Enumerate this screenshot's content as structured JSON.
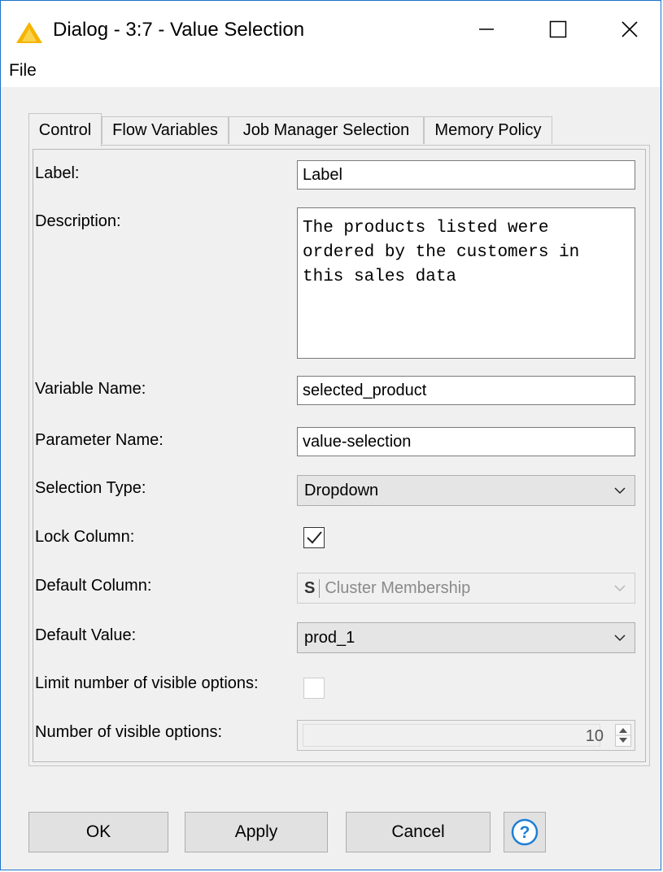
{
  "window": {
    "title": "Dialog - 3:7 - Value Selection",
    "icon": "warning-triangle-icon",
    "accent": "#f5b400"
  },
  "menu": {
    "file": "File"
  },
  "tabs": [
    {
      "label": "Control",
      "active": true
    },
    {
      "label": "Flow Variables",
      "active": false
    },
    {
      "label": "Job Manager Selection",
      "active": false
    },
    {
      "label": "Memory Policy",
      "active": false
    }
  ],
  "form": {
    "label": {
      "caption": "Label:",
      "value": "Label"
    },
    "description": {
      "caption": "Description:",
      "value": "The products listed were ordered by the customers in this sales data"
    },
    "variable_name": {
      "caption": "Variable Name:",
      "value": "selected_product"
    },
    "parameter_name": {
      "caption": "Parameter Name:",
      "value": "value-selection"
    },
    "selection_type": {
      "caption": "Selection Type:",
      "value": "Dropdown"
    },
    "lock_column": {
      "caption": "Lock Column:",
      "checked": true
    },
    "default_column": {
      "caption": "Default Column:",
      "type_badge": "S",
      "value": "Cluster Membership",
      "disabled": true
    },
    "default_value": {
      "caption": "Default Value:",
      "value": "prod_1"
    },
    "limit_options": {
      "caption": "Limit number of visible options:",
      "checked": false,
      "disabled": true
    },
    "visible_options": {
      "caption": "Number of visible options:",
      "value": "10",
      "disabled": true
    }
  },
  "buttons": {
    "ok": "OK",
    "apply": "Apply",
    "cancel": "Cancel",
    "help_icon": "question-circle-icon",
    "help_color": "#1e7fd6"
  }
}
